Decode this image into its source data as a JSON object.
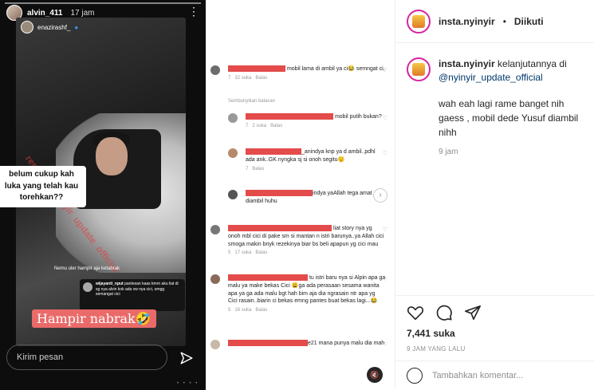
{
  "story": {
    "user": "alvin_411",
    "time": "17 jam",
    "inner_user": "enazirashf_",
    "caption": "belum cukup kah luka  yang telah kau torehkan??",
    "watermark": "repost @nyinyir_update_official",
    "note": "Nemu uler hampir aja ketabrak",
    "mini_comment_user": "wijayanti_nput",
    "mini_comment_text": "pantesan kaas kmrn aku liat di sg nya alvin kok ada vw nya cici, omgg semangat cici",
    "sticker": "Hampir nabrak🤣",
    "input_placeholder": "Kirim pesan"
  },
  "comments": [
    {
      "text": "mobil lama di ambil ya ci😂 semngat ci,",
      "likes": "32 suka",
      "reply": "Balas"
    },
    {
      "text": "mobil putih bukan?",
      "likes": "2 suka",
      "reply": "Balas"
    },
    {
      "text": "_anindya knp ya d ambil..pdhl ada ank..GK nyngka sj si onoh segitu😟",
      "likes": "",
      "reply": "Balas"
    },
    {
      "text": "indya yaAllah tega amat diambil huhu",
      "likes": "",
      "reply": ""
    },
    {
      "text": "liat story nya yg onoh mbl cici di pake sm si mantan n istri barunya..ya Allah cici smoga makin bnyk rezekinya biar bs beli apapun yg cici mau",
      "likes": "17 suka",
      "reply": "Balas"
    },
    {
      "text": "tu istri baru nya si Alpin apa ga malu ya make bekas Cici 😩ga ada perasaan sesama wanita apa ya ga ada malu bgt hah bim aja dia ngrasain ntr apa yg Cici rasain..biarin ci bekas emng pantes buat bekas lagi...😂",
      "likes": "16 suka",
      "reply": "Balas"
    },
    {
      "text": "e21 mana punya malu dia mah",
      "likes": "",
      "reply": ""
    }
  ],
  "hide_replies": "Sembunyikan balasan",
  "sidebar": {
    "user": "insta.nyinyir",
    "dot": "•",
    "follow_status": "Diikuti",
    "caption_user": "insta.nyinyir",
    "caption_text": "kelanjutannya di",
    "mention": "@nyinyir_update_official",
    "message": "wah eah lagi rame banget nih gaess , mobil dede Yusuf diambil nihh",
    "caption_time": "9 jam",
    "likes": "7,441 suka",
    "ago": "9 JAM YANG LALU",
    "add_comment_placeholder": "Tambahkan komentar..."
  }
}
